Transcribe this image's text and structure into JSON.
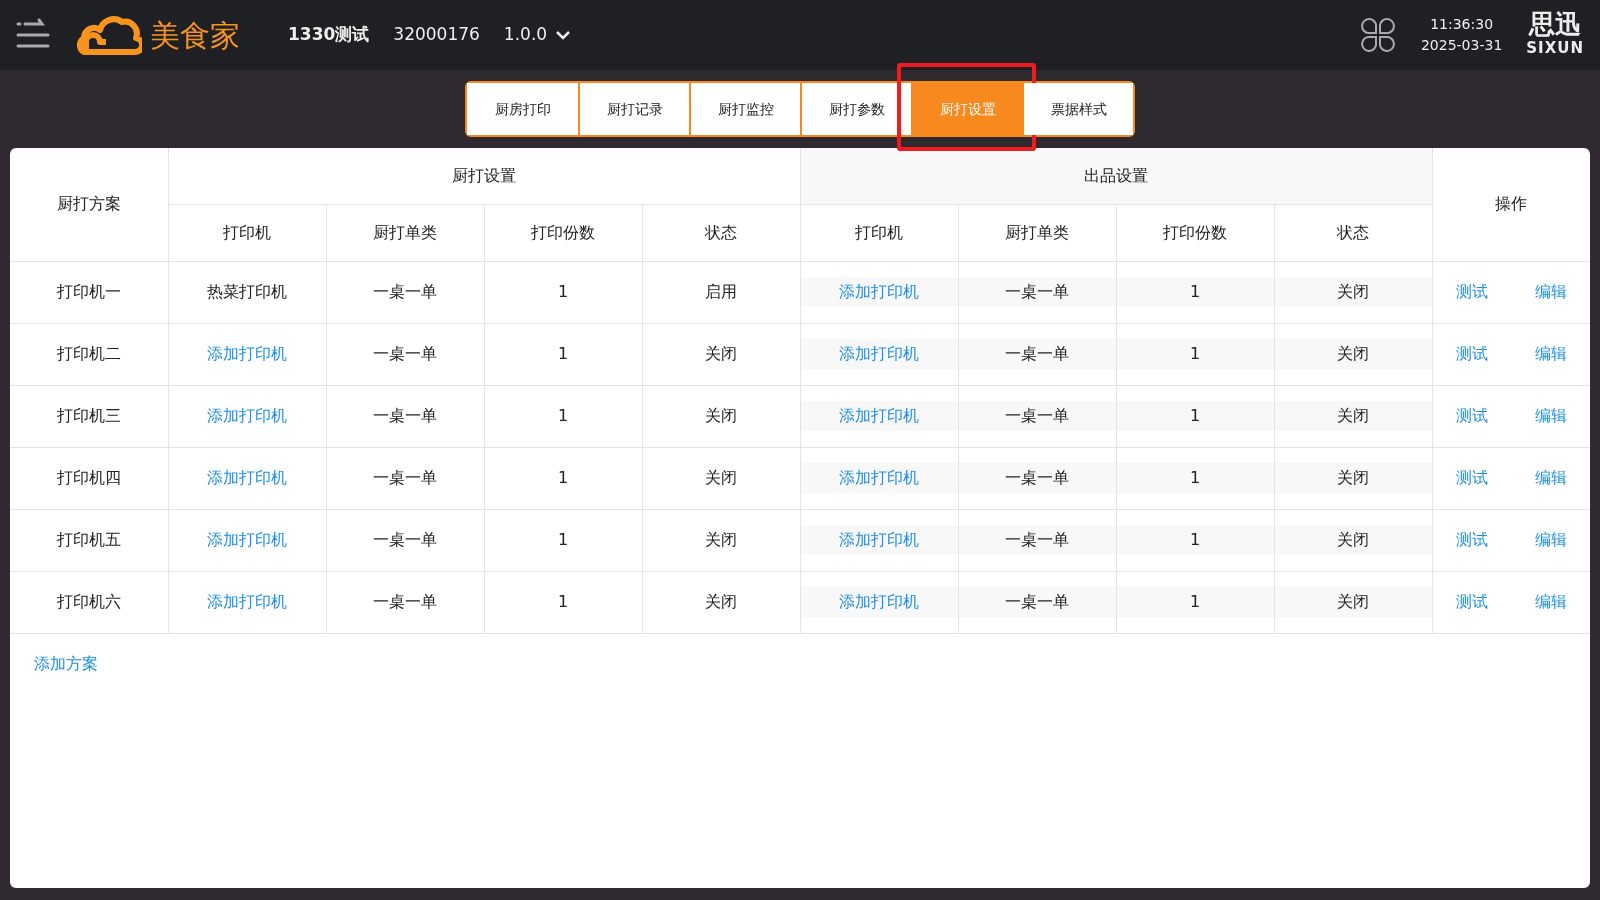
{
  "header": {
    "store": "1330测试",
    "store_id": "32000176",
    "version": "1.0.0",
    "brand": "美食家",
    "time": "11:36:30",
    "date": "2025-03-31",
    "vendor_cn": "思迅",
    "vendor_en": "SIXUN"
  },
  "tabs": [
    {
      "label": "厨房打印",
      "selected": false,
      "highlighted": false
    },
    {
      "label": "厨打记录",
      "selected": false,
      "highlighted": false
    },
    {
      "label": "厨打监控",
      "selected": false,
      "highlighted": false
    },
    {
      "label": "厨打参数",
      "selected": false,
      "highlighted": false
    },
    {
      "label": "厨打设置",
      "selected": true,
      "highlighted": true
    },
    {
      "label": "票据样式",
      "selected": false,
      "highlighted": false
    }
  ],
  "table": {
    "plan_header": "厨打方案",
    "groups": [
      {
        "title": "厨打设置",
        "columns": [
          "打印机",
          "厨打单类",
          "打印份数",
          "状态"
        ]
      },
      {
        "title": "出品设置",
        "columns": [
          "打印机",
          "厨打单类",
          "打印份数",
          "状态"
        ]
      }
    ],
    "actions_header": "操作",
    "rows": [
      {
        "plan": "打印机一",
        "kitchen": {
          "printer": {
            "text": "热菜打印机",
            "kind": "text"
          },
          "type": "一桌一单",
          "copies": "1",
          "status": "启用"
        },
        "output": {
          "printer": {
            "text": "添加打印机",
            "kind": "link"
          },
          "type": "一桌一单",
          "copies": "1",
          "status": "关闭"
        },
        "actions": [
          "测试",
          "编辑"
        ]
      },
      {
        "plan": "打印机二",
        "kitchen": {
          "printer": {
            "text": "添加打印机",
            "kind": "link"
          },
          "type": "一桌一单",
          "copies": "1",
          "status": "关闭"
        },
        "output": {
          "printer": {
            "text": "添加打印机",
            "kind": "link"
          },
          "type": "一桌一单",
          "copies": "1",
          "status": "关闭"
        },
        "actions": [
          "测试",
          "编辑"
        ]
      },
      {
        "plan": "打印机三",
        "kitchen": {
          "printer": {
            "text": "添加打印机",
            "kind": "link"
          },
          "type": "一桌一单",
          "copies": "1",
          "status": "关闭"
        },
        "output": {
          "printer": {
            "text": "添加打印机",
            "kind": "link"
          },
          "type": "一桌一单",
          "copies": "1",
          "status": "关闭"
        },
        "actions": [
          "测试",
          "编辑"
        ]
      },
      {
        "plan": "打印机四",
        "kitchen": {
          "printer": {
            "text": "添加打印机",
            "kind": "link"
          },
          "type": "一桌一单",
          "copies": "1",
          "status": "关闭"
        },
        "output": {
          "printer": {
            "text": "添加打印机",
            "kind": "link"
          },
          "type": "一桌一单",
          "copies": "1",
          "status": "关闭"
        },
        "actions": [
          "测试",
          "编辑"
        ]
      },
      {
        "plan": "打印机五",
        "kitchen": {
          "printer": {
            "text": "添加打印机",
            "kind": "link"
          },
          "type": "一桌一单",
          "copies": "1",
          "status": "关闭"
        },
        "output": {
          "printer": {
            "text": "添加打印机",
            "kind": "link"
          },
          "type": "一桌一单",
          "copies": "1",
          "status": "关闭"
        },
        "actions": [
          "测试",
          "编辑"
        ]
      },
      {
        "plan": "打印机六",
        "kitchen": {
          "printer": {
            "text": "添加打印机",
            "kind": "link"
          },
          "type": "一桌一单",
          "copies": "1",
          "status": "关闭"
        },
        "output": {
          "printer": {
            "text": "添加打印机",
            "kind": "link"
          },
          "type": "一桌一单",
          "copies": "1",
          "status": "关闭"
        },
        "actions": [
          "测试",
          "编辑"
        ]
      }
    ]
  },
  "add_plan": "添加方案"
}
